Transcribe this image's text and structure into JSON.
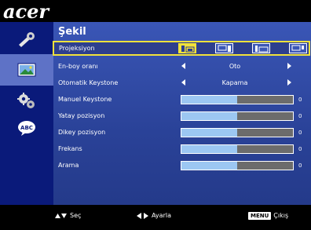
{
  "brand": {
    "logo_text": "acer"
  },
  "sidebar": {
    "items": [
      {
        "icon": "wrench-icon",
        "label": ""
      },
      {
        "icon": "picture-icon",
        "label": "",
        "active": true
      },
      {
        "icon": "gears-icon",
        "label": ""
      },
      {
        "icon": "abc-speech-icon",
        "label": "ABC"
      }
    ]
  },
  "panel": {
    "title": "Şekil",
    "rows": [
      {
        "label": "Projeksiyon",
        "type": "icons",
        "selected": true,
        "options": [
          "front-desktop-icon",
          "front-ceiling-icon",
          "rear-desktop-icon",
          "rear-ceiling-icon"
        ],
        "active_index": 0
      },
      {
        "label": "En-boy oranı",
        "type": "select",
        "value": "Oto"
      },
      {
        "label": "Otomatik Keystone",
        "type": "select",
        "value": "Kapama"
      },
      {
        "label": "Manuel Keystone",
        "type": "slider",
        "value": "0",
        "fill_fraction": 0.5
      },
      {
        "label": "Yatay pozisyon",
        "type": "slider",
        "value": "0",
        "fill_fraction": 0.5
      },
      {
        "label": "Dikey pozisyon",
        "type": "slider",
        "value": "0",
        "fill_fraction": 0.5
      },
      {
        "label": "Frekans",
        "type": "slider",
        "value": "0",
        "fill_fraction": 0.5
      },
      {
        "label": "Arama",
        "type": "slider",
        "value": "0",
        "fill_fraction": 0.5
      }
    ]
  },
  "footer": {
    "select_label": "Seç",
    "adjust_label": "Ayarla",
    "menu_key": "MENU",
    "exit_label": "Çıkış"
  },
  "colors": {
    "selection_outline": "#f2e23a",
    "slider_fill": "#9cc7f2",
    "panel_blue": "#3a56b6",
    "sidebar_blue": "#0a1a7a"
  }
}
